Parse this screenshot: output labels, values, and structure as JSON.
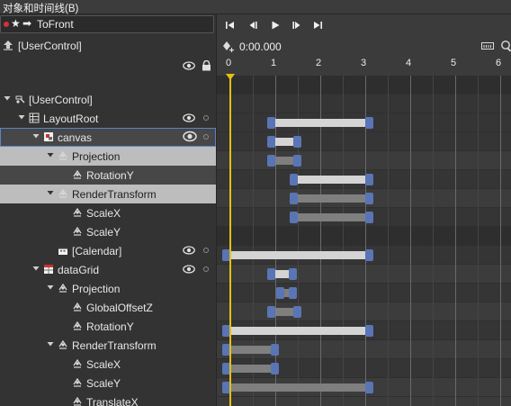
{
  "window": {
    "title": "对象和时间线(B)"
  },
  "storyboard": {
    "name": "ToFront"
  },
  "scope": {
    "name": "[UserControl]"
  },
  "timeline": {
    "time": "0:00.000",
    "ruler_ticks": [
      "0",
      "1",
      "2",
      "3",
      "4",
      "5",
      "6"
    ]
  },
  "tree": [
    {
      "label": "[UserControl]",
      "icon": "usercontrol-icon"
    },
    {
      "label": "LayoutRoot",
      "icon": "grid-icon"
    },
    {
      "label": "canvas",
      "icon": "canvas-icon"
    },
    {
      "label": "Projection",
      "icon": "transform-icon"
    },
    {
      "label": "RotationY",
      "icon": "transform-icon"
    },
    {
      "label": "RenderTransform",
      "icon": "transform-icon"
    },
    {
      "label": "ScaleX",
      "icon": "transform-icon"
    },
    {
      "label": "ScaleY",
      "icon": "transform-icon"
    },
    {
      "label": "[Calendar]",
      "icon": "calendar-icon"
    },
    {
      "label": "dataGrid",
      "icon": "datagrid-icon"
    },
    {
      "label": "Projection",
      "icon": "transform-icon"
    },
    {
      "label": "GlobalOffsetZ",
      "icon": "transform-icon"
    },
    {
      "label": "RotationY",
      "icon": "transform-icon"
    },
    {
      "label": "RenderTransform",
      "icon": "transform-icon"
    },
    {
      "label": "ScaleX",
      "icon": "transform-icon"
    },
    {
      "label": "ScaleY",
      "icon": "transform-icon"
    },
    {
      "label": "TranslateX",
      "icon": "transform-icon"
    }
  ],
  "colors": {
    "accent": "#5a75b5",
    "playhead": "#e6c010",
    "record": "#d2323c"
  }
}
